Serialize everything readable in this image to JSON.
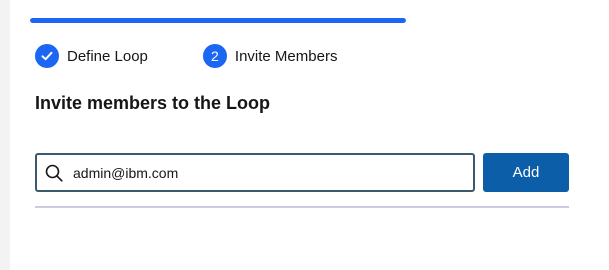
{
  "progress": {
    "value_fraction": 1.0,
    "color": "#1b66f2"
  },
  "steps": [
    {
      "label": "Define Loop",
      "state": "complete",
      "icon": "checkmark-icon"
    },
    {
      "label": "Invite Members",
      "state": "current",
      "number": "2"
    }
  ],
  "page": {
    "title": "Invite members to the Loop"
  },
  "search": {
    "icon": "search-icon",
    "value": "admin@ibm.com"
  },
  "buttons": {
    "add_label": "Add",
    "add_color": "#0d5ea8"
  }
}
